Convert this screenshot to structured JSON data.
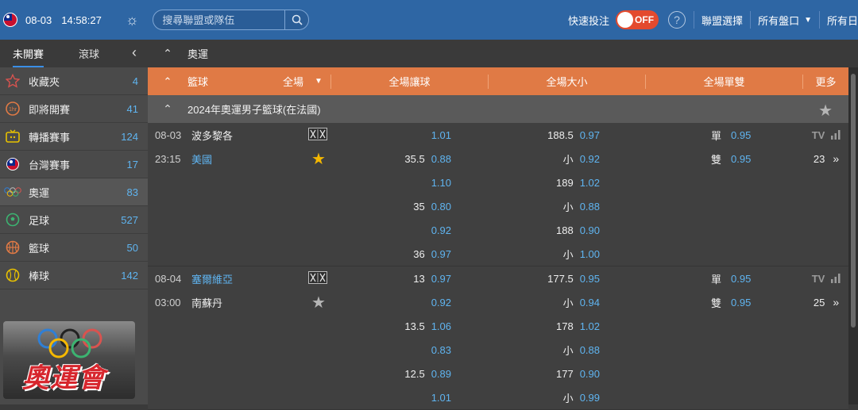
{
  "topbar": {
    "date": "08-03",
    "time": "14:58:27",
    "search_placeholder": "搜尋聯盟或隊伍",
    "quick_bet_label": "快速投注",
    "toggle_state": "OFF",
    "league_select": "聯盟選擇",
    "all_markets": "所有盤口",
    "all_days": "所有日"
  },
  "sidebar": {
    "tabs": [
      "未開賽",
      "滾球"
    ],
    "items": [
      {
        "label": "收藏夾",
        "count": "4",
        "icon": "star-outline-icon"
      },
      {
        "label": "即將開賽",
        "count": "41",
        "icon": "1hr-icon"
      },
      {
        "label": "轉播賽事",
        "count": "124",
        "icon": "tv-icon"
      },
      {
        "label": "台灣賽事",
        "count": "17",
        "icon": "taiwan-flag-icon"
      },
      {
        "label": "奧運",
        "count": "83",
        "icon": "olympic-rings-icon"
      },
      {
        "label": "足球",
        "count": "527",
        "icon": "soccer-icon"
      },
      {
        "label": "籃球",
        "count": "50",
        "icon": "basketball-icon"
      },
      {
        "label": "棒球",
        "count": "142",
        "icon": "baseball-icon"
      }
    ],
    "banner_text": "奧運會"
  },
  "main": {
    "breadcrumb": "奧運",
    "header": {
      "sport": "籃球",
      "period": "全場",
      "col_handicap": "全場讓球",
      "col_overunder": "全場大小",
      "col_oddeven": "全場單雙",
      "col_more": "更多"
    },
    "league": "2024年奧運男子籃球(在法國)",
    "matches": [
      {
        "date": "08-03",
        "time": "23:15",
        "home": "波多黎各",
        "away": "美國",
        "starred": true,
        "more_count": "23",
        "tv": "TV",
        "rows": [
          {
            "hdp_line": "",
            "hdp_odds": "1.01",
            "ou_line": "188.5",
            "ou_odds": "0.97",
            "oe_label": "單",
            "oe_odds": "0.95"
          },
          {
            "hdp_line": "35.5",
            "hdp_odds": "0.88",
            "ou_line": "小",
            "ou_odds": "0.92",
            "oe_label": "雙",
            "oe_odds": "0.95"
          },
          {
            "hdp_line": "",
            "hdp_odds": "1.10",
            "ou_line": "189",
            "ou_odds": "1.02",
            "oe_label": "",
            "oe_odds": ""
          },
          {
            "hdp_line": "35",
            "hdp_odds": "0.80",
            "ou_line": "小",
            "ou_odds": "0.88",
            "oe_label": "",
            "oe_odds": ""
          },
          {
            "hdp_line": "",
            "hdp_odds": "0.92",
            "ou_line": "188",
            "ou_odds": "0.90",
            "oe_label": "",
            "oe_odds": ""
          },
          {
            "hdp_line": "36",
            "hdp_odds": "0.97",
            "ou_line": "小",
            "ou_odds": "1.00",
            "oe_label": "",
            "oe_odds": ""
          }
        ]
      },
      {
        "date": "08-04",
        "time": "03:00",
        "home": "塞爾維亞",
        "away": "南蘇丹",
        "starred": false,
        "more_count": "25",
        "tv": "TV",
        "rows": [
          {
            "hdp_line": "13",
            "hdp_odds": "0.97",
            "ou_line": "177.5",
            "ou_odds": "0.95",
            "oe_label": "單",
            "oe_odds": "0.95"
          },
          {
            "hdp_line": "",
            "hdp_odds": "0.92",
            "ou_line": "小",
            "ou_odds": "0.94",
            "oe_label": "雙",
            "oe_odds": "0.95"
          },
          {
            "hdp_line": "13.5",
            "hdp_odds": "1.06",
            "ou_line": "178",
            "ou_odds": "1.02",
            "oe_label": "",
            "oe_odds": ""
          },
          {
            "hdp_line": "",
            "hdp_odds": "0.83",
            "ou_line": "小",
            "ou_odds": "0.88",
            "oe_label": "",
            "oe_odds": ""
          },
          {
            "hdp_line": "12.5",
            "hdp_odds": "0.89",
            "ou_line": "177",
            "ou_odds": "0.90",
            "oe_label": "",
            "oe_odds": ""
          },
          {
            "hdp_line": "",
            "hdp_odds": "1.01",
            "ou_line": "小",
            "ou_odds": "0.99",
            "oe_label": "",
            "oe_odds": ""
          }
        ]
      }
    ]
  },
  "colors": {
    "topbar": "#2e66a4",
    "header_orange": "#e07a45",
    "odds_blue": "#5fb4f0",
    "star_gold": "#f5b800"
  }
}
